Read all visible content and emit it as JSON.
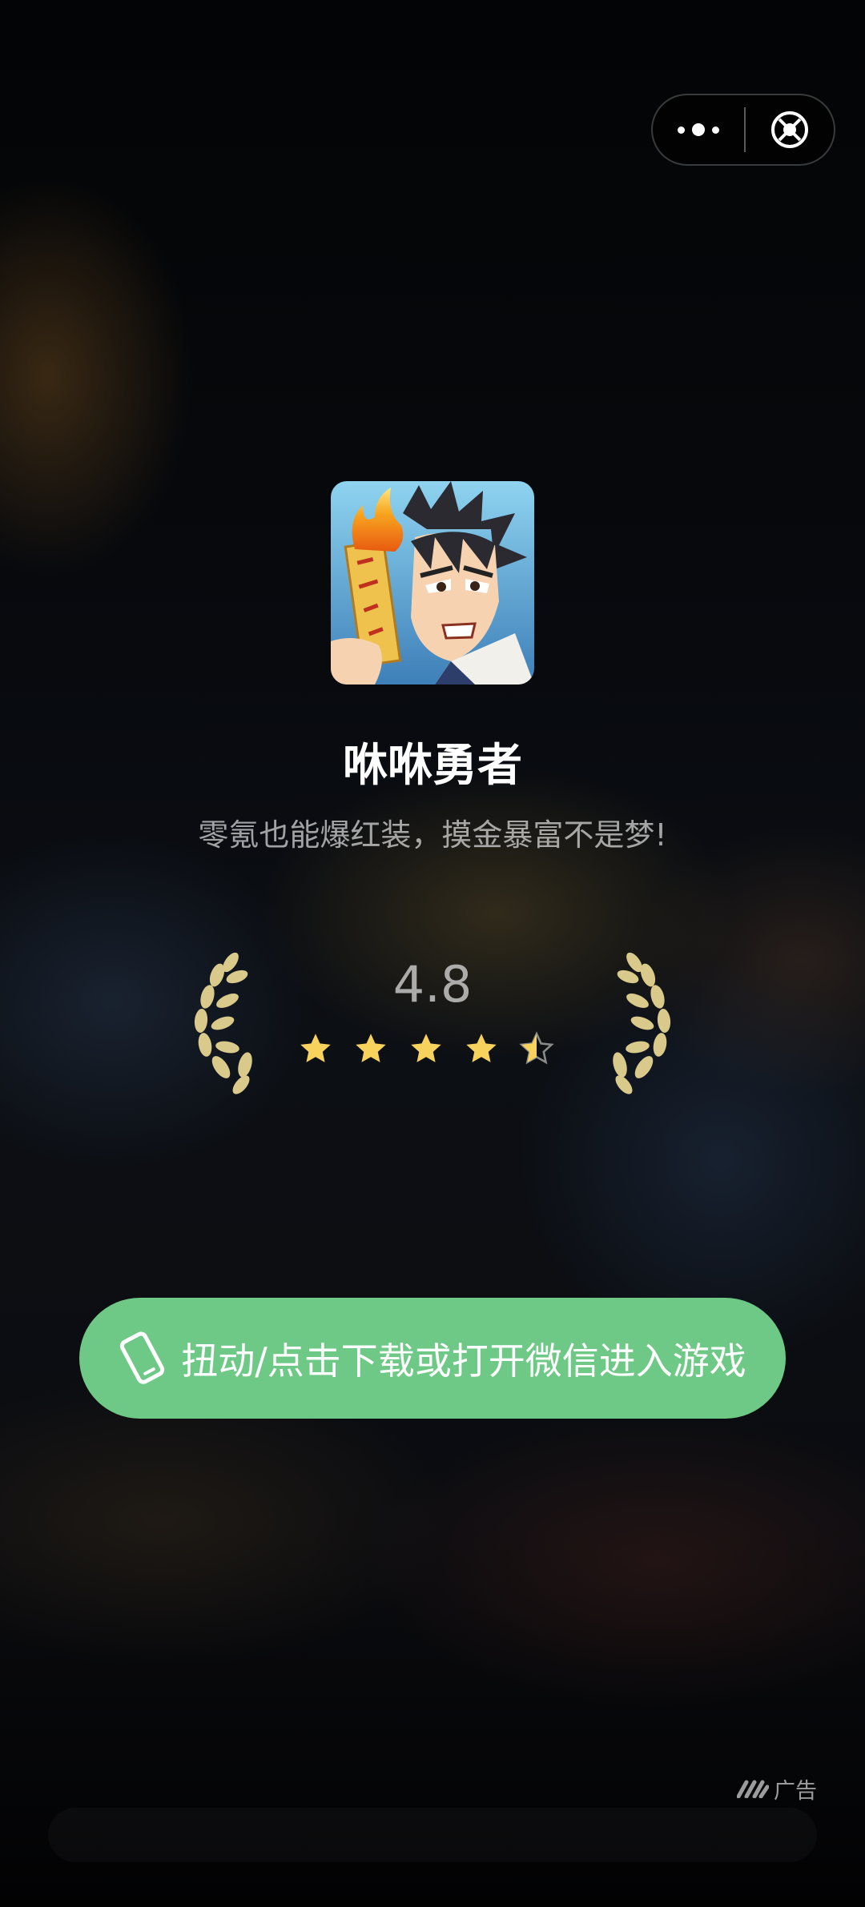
{
  "capsule": {
    "more_icon": "more-dots-icon",
    "close_icon": "close-target-icon"
  },
  "app": {
    "name": "咻咻勇者",
    "slogan": "零氪也能爆红装，摸金暴富不是梦!",
    "icon": "game-avatar-icon"
  },
  "rating": {
    "score": "4.8",
    "stars": 4.5,
    "star_color": "#f7d35e"
  },
  "cta": {
    "label": "扭动/点击下载或打开微信进入游戏",
    "color": "#6dc985",
    "icon": "phone-tilt-icon"
  },
  "ad": {
    "label": "广告",
    "icon": "ad-logo-icon"
  }
}
